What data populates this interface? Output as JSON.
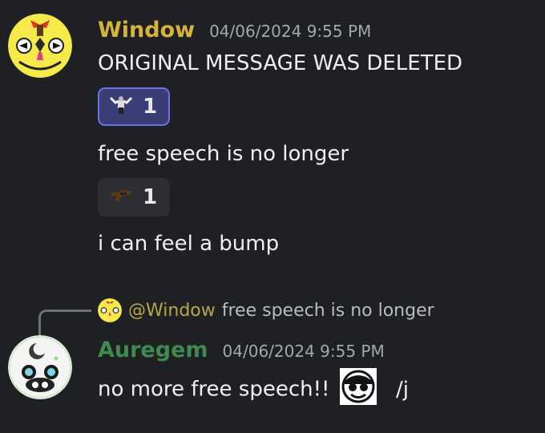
{
  "messages": [
    {
      "author": "Window",
      "author_color": "#d4b53a",
      "timestamp": "04/06/2024 9:55 PM",
      "lines": [
        {
          "text": "ORIGINAL MESSAGE WAS DELETED",
          "reaction": {
            "emoji": "flexing-figure-emoji",
            "count": "1",
            "active": true
          }
        },
        {
          "text": "free speech is no longer",
          "reaction": {
            "emoji": "gun-emoji",
            "count": "1",
            "active": false
          }
        },
        {
          "text": "i can feel a bump"
        }
      ]
    },
    {
      "author": "Auregem",
      "author_color": "#3f8a4f",
      "timestamp": "04/06/2024 9:55 PM",
      "reply": {
        "mention": "@Window",
        "text": "free speech is no longer"
      },
      "text_before": "no more free speech!!",
      "text_after": "/j"
    }
  ],
  "colors": {
    "background": "#1f2023",
    "reaction_active_bg": "#3a3e76",
    "reaction_active_border": "#6c71e8",
    "reaction_inactive_bg": "#2c2e33"
  }
}
